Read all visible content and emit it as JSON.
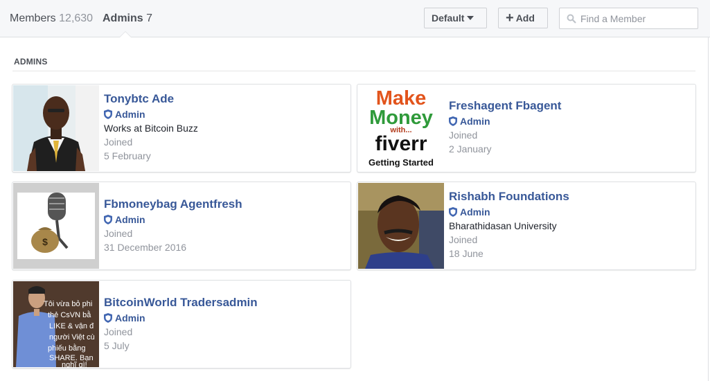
{
  "tabs": {
    "members_label": "Members",
    "members_count": "12,630",
    "admins_label": "Admins",
    "admins_count": "7"
  },
  "toolbar": {
    "sort_label": "Default",
    "add_label": "Add",
    "search_placeholder": "Find a Member"
  },
  "section": {
    "title": "ADMINS"
  },
  "admins": [
    {
      "name": "Tonybtc Ade",
      "role": "Admin",
      "detail": "Works at Bitcoin Buzz",
      "joined_label": "Joined",
      "joined_date": "5 February"
    },
    {
      "name": "Freshagent Fbagent",
      "role": "Admin",
      "joined_label": "Joined",
      "joined_date": "2 January"
    },
    {
      "name": "Fbmoneybag Agentfresh",
      "role": "Admin",
      "joined_label": "Joined",
      "joined_date": "31 December 2016"
    },
    {
      "name": "Rishabh Foundations",
      "role": "Admin",
      "detail": "Bharathidasan University",
      "joined_label": "Joined",
      "joined_date": "18 June"
    },
    {
      "name": "BitcoinWorld Tradersadmin",
      "role": "Admin",
      "joined_label": "Joined",
      "joined_date": "5 July"
    }
  ],
  "photo_text": {
    "fiverr": [
      "Make",
      "Money",
      "with...",
      "fiverr",
      "Getting Started"
    ],
    "vn": [
      "Tôi vừa bỏ phi",
      "thẻ CsVN bằ",
      "LIKE & vận đ",
      "người Việt cù",
      "phiếu bằng",
      "SHARE. Bạn",
      "nghĩ gì!"
    ]
  },
  "colors": {
    "link": "#385898",
    "muted": "#90949c",
    "topbar_bg": "#f6f7f9",
    "border": "#dddfe2"
  }
}
